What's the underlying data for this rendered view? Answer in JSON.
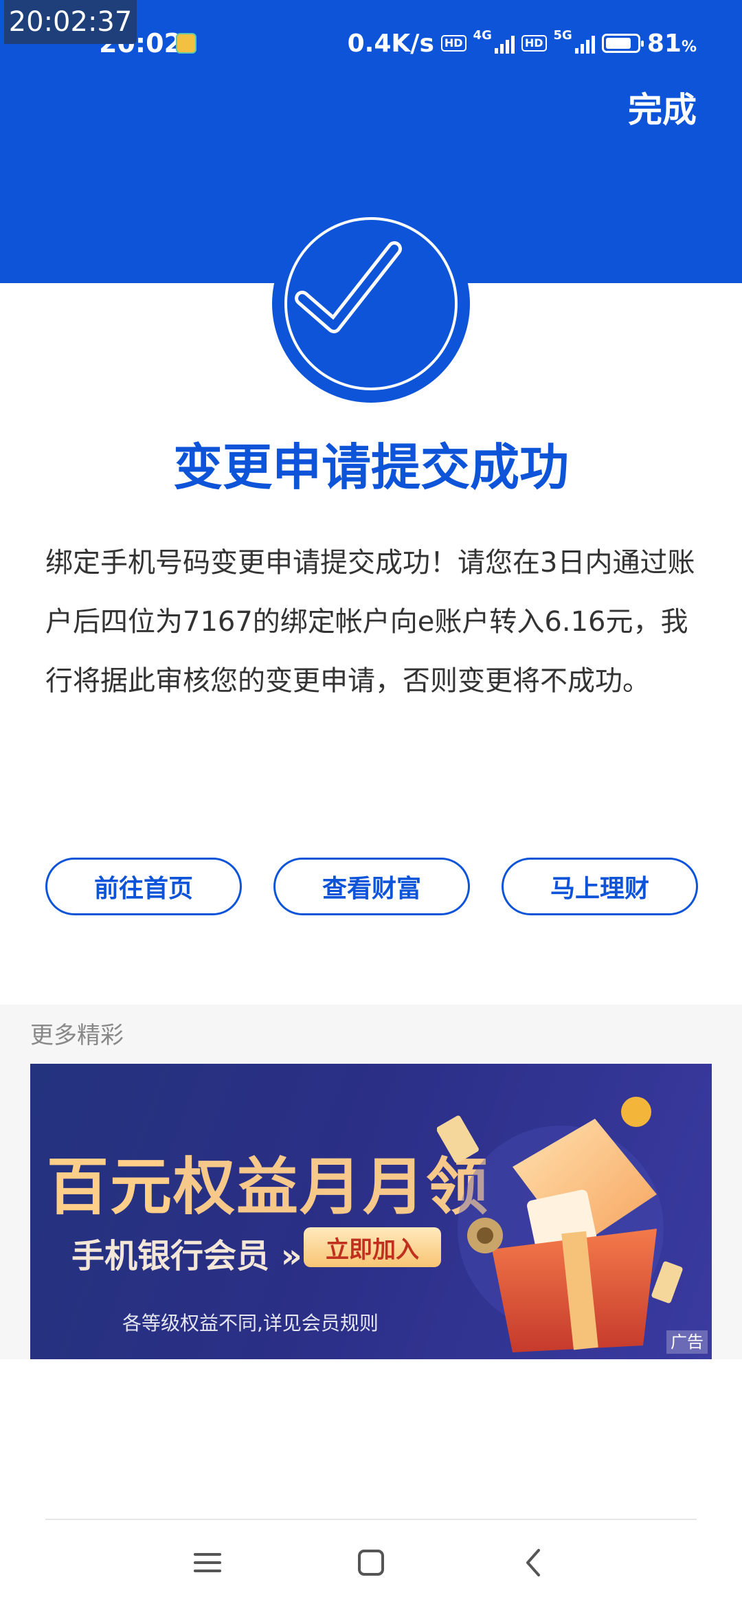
{
  "overlay": {
    "time": "20:02:37"
  },
  "status_bar": {
    "time": "20:02",
    "net_speed": "0.4K/s",
    "hd": "HD",
    "net1": "4G",
    "net2": "5G",
    "battery_level": 81,
    "battery_text": "81",
    "battery_unit": "%"
  },
  "header": {
    "done_label": "完成"
  },
  "result": {
    "title": "变更申请提交成功",
    "message": "绑定手机号码变更申请提交成功！请您在3日内通过账户后四位为7167的绑定帐户向e账户转入6.16元，我行将据此审核您的变更申请，否则变更将不成功。"
  },
  "actions": {
    "home": "前往首页",
    "wealth": "查看财富",
    "invest": "马上理财"
  },
  "more": {
    "title": "更多精彩",
    "banner": {
      "title_strong": "百元",
      "title_rest": "权益月月领",
      "subtitle": "手机银行会员",
      "arrow": "»",
      "cta": "立即加入",
      "note": "各等级权益不同,详见会员规则",
      "ad_tag": "广告"
    }
  },
  "colors": {
    "primary": "#0d54d9"
  }
}
